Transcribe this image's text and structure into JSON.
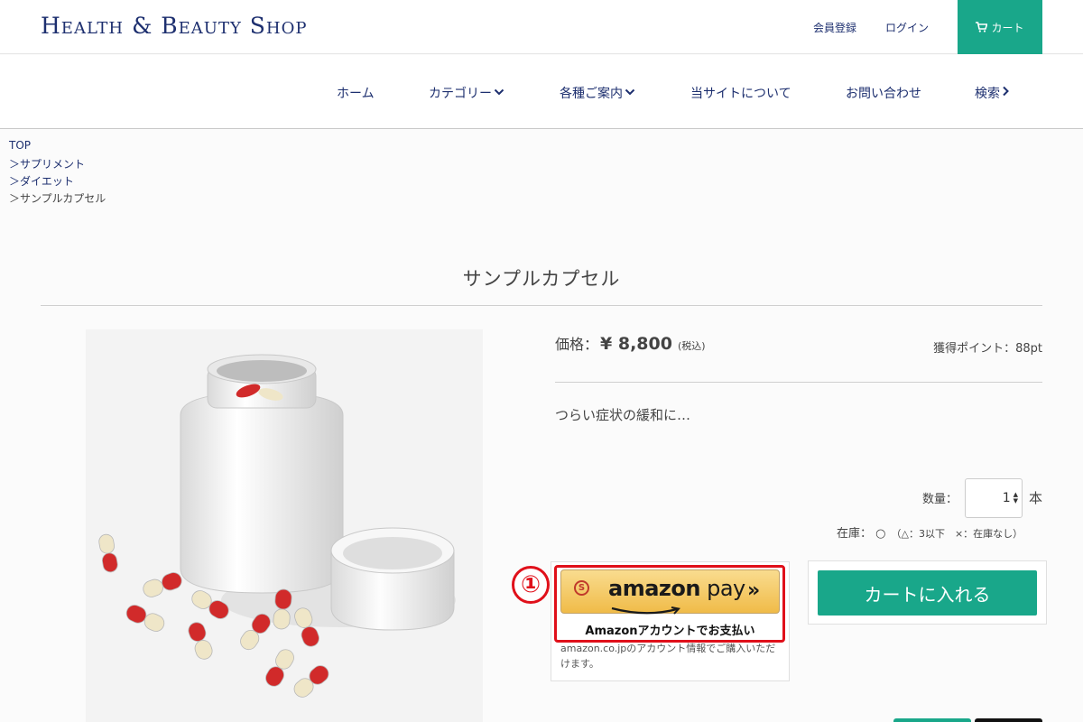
{
  "header": {
    "logo": "Health & Beauty Shop",
    "register": "会員登録",
    "login": "ログイン",
    "cart": "カート",
    "cart_icon": "shopping-cart-icon"
  },
  "nav": {
    "home": "ホーム",
    "category": "カテゴリー",
    "info": "各種ご案内",
    "about": "当サイトについて",
    "contact": "お問い合わせ",
    "search": "検索"
  },
  "breadcrumb": [
    "TOP",
    "＞サプリメント",
    "＞ダイエット",
    "＞サンプルカプセル"
  ],
  "product": {
    "title": "サンプルカプセル",
    "price_label": "価格：",
    "price_value": "¥ 8,800",
    "tax_note": "(税込)",
    "points": "獲得ポイント：88pt",
    "description": "つらい症状の緩和に…",
    "quantity_label": "数量：",
    "quantity_value": "1",
    "quantity_unit": "本",
    "stock_label": "在庫： ○",
    "stock_note": "（△：3以下　×：在庫なし）"
  },
  "amazon": {
    "annotation_number": "①",
    "coin_icon": "S",
    "brand": "amazon",
    "pay": " pay",
    "chevrons": "»",
    "caption": "Amazonアカウントでお支払い",
    "note": "amazon.co.jpのアカウント情報でご購入いただけます。"
  },
  "cart_button": "カートに入れる",
  "colors": {
    "brand_navy": "#1d2f6f",
    "accent_green": "#19a78a",
    "highlight_red": "#e0101a",
    "amazon_gold": "#f0bb48"
  }
}
